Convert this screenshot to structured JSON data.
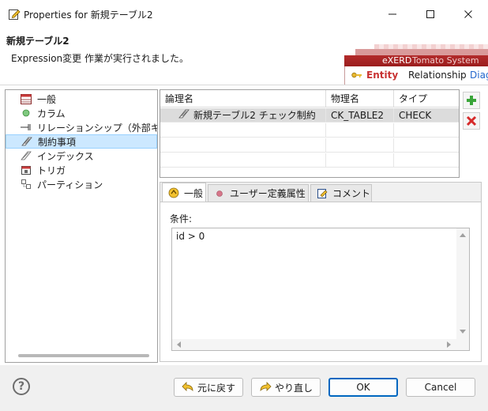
{
  "window": {
    "title": "Properties for 新規テーブル2",
    "icon": "edit-window-icon"
  },
  "header": {
    "title": "新規テーブル2",
    "message": "Expression変更 作業が実行されました。"
  },
  "banner": {
    "product": "eXERD",
    "vendor": "Tomato System",
    "tab_entity": "Entity",
    "tab_relationship": "Relationship",
    "tab_diagram": "Diag",
    "accent": "#b32b2b"
  },
  "nav": {
    "items": [
      {
        "label": "一般",
        "icon": "table-icon"
      },
      {
        "label": "カラム",
        "icon": "column-dot-icon"
      },
      {
        "label": "リレーションシップ（外部キ",
        "icon": "relationship-arrow-icon"
      },
      {
        "label": "制約事項",
        "icon": "constraint-icon",
        "selected": true
      },
      {
        "label": "インデックス",
        "icon": "index-icon"
      },
      {
        "label": "トリガ",
        "icon": "trigger-icon"
      },
      {
        "label": "パーティション",
        "icon": "partition-icon"
      }
    ]
  },
  "table": {
    "headers": [
      "論理名",
      "物理名",
      "タイプ"
    ],
    "rows": [
      {
        "logical": "新規テーブル2 チェック制約",
        "physical": "CK_TABLE2",
        "type": "CHECK",
        "selected": true
      }
    ]
  },
  "side_buttons": {
    "add": "add-icon",
    "delete": "delete-icon"
  },
  "tabs": [
    {
      "label": "一般",
      "icon": "general-tab-icon",
      "active": true
    },
    {
      "label": "ユーザー定義属性",
      "icon": "user-attr-dot-icon"
    },
    {
      "label": "コメント",
      "icon": "comment-icon"
    }
  ],
  "condition": {
    "label": "条件:",
    "value": "id > 0"
  },
  "buttons": {
    "undo": "元に戻す",
    "redo": "やり直し",
    "ok": "OK",
    "cancel": "Cancel",
    "help": "?"
  }
}
